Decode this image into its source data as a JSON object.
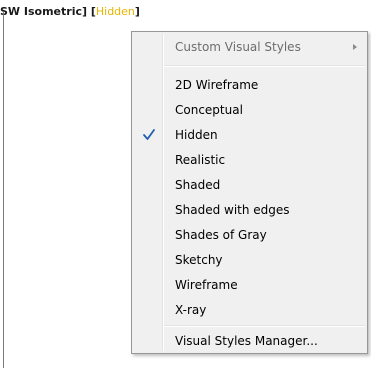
{
  "viewport_label": {
    "prefix": "SW Isometric] [",
    "style": "Hidden",
    "suffix": "]"
  },
  "menu": {
    "submenu_item": "Custom Visual Styles",
    "styles": [
      "2D Wireframe",
      "Conceptual",
      "Hidden",
      "Realistic",
      "Shaded",
      "Shaded with edges",
      "Shades of Gray",
      "Sketchy",
      "Wireframe",
      "X-ray"
    ],
    "checked_style": "Hidden",
    "manager_item": "Visual Styles Manager..."
  },
  "colors": {
    "highlight_text": "#e8b400",
    "check": "#1f5fb0"
  }
}
